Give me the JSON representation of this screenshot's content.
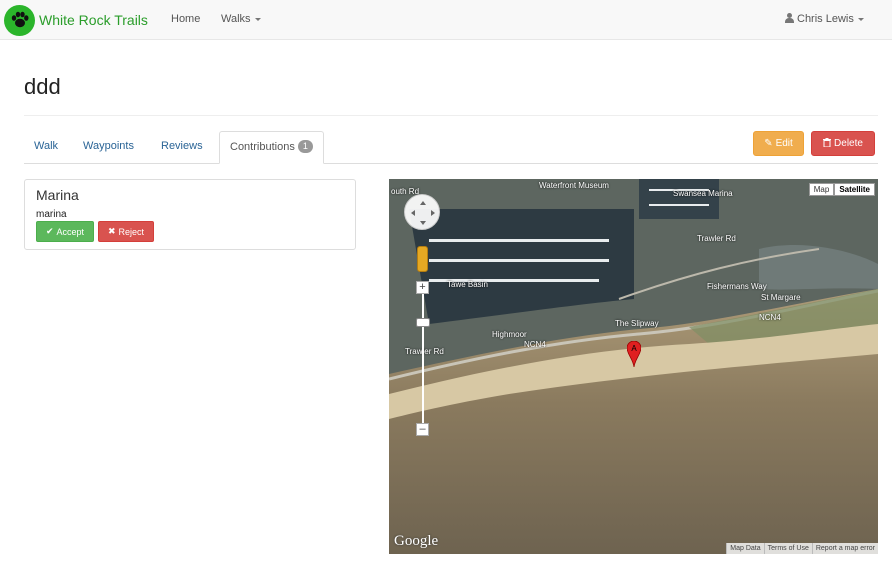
{
  "navbar": {
    "brand": "White Rock Trails",
    "logo_icon": "paw-icon",
    "home": "Home",
    "walks": "Walks",
    "user": "Chris Lewis"
  },
  "page": {
    "title": "ddd"
  },
  "tabs": [
    {
      "label": "Walk"
    },
    {
      "label": "Waypoints"
    },
    {
      "label": "Reviews"
    },
    {
      "label": "Contributions",
      "badge": "1"
    }
  ],
  "actions": {
    "edit": "Edit",
    "delete": "Delete"
  },
  "contribution": {
    "title": "Marina",
    "description": "marina",
    "accept": "Accept",
    "reject": "Reject"
  },
  "map": {
    "type_map": "Map",
    "type_satellite": "Satellite",
    "marker_label": "A",
    "logo": "Google",
    "footer": [
      "Map Data",
      "Terms of Use",
      "Report a map error"
    ],
    "places": {
      "waterfront_museum": "Waterfront Museum",
      "swansea_marina": "Swansea Marina",
      "tawe_basin": "Tawe Basin",
      "trawler_rd": "Trawler Rd",
      "fishermans_way": "Fishermans Way",
      "st_margaret": "St Margare",
      "highmoor": "Highmoor",
      "the_slipway": "The Slipway",
      "ncn4_a": "NCN4",
      "ncn4_b": "NCN4",
      "trawler_rd_2": "Trawler Rd",
      "south_rd": "outh Rd"
    }
  }
}
